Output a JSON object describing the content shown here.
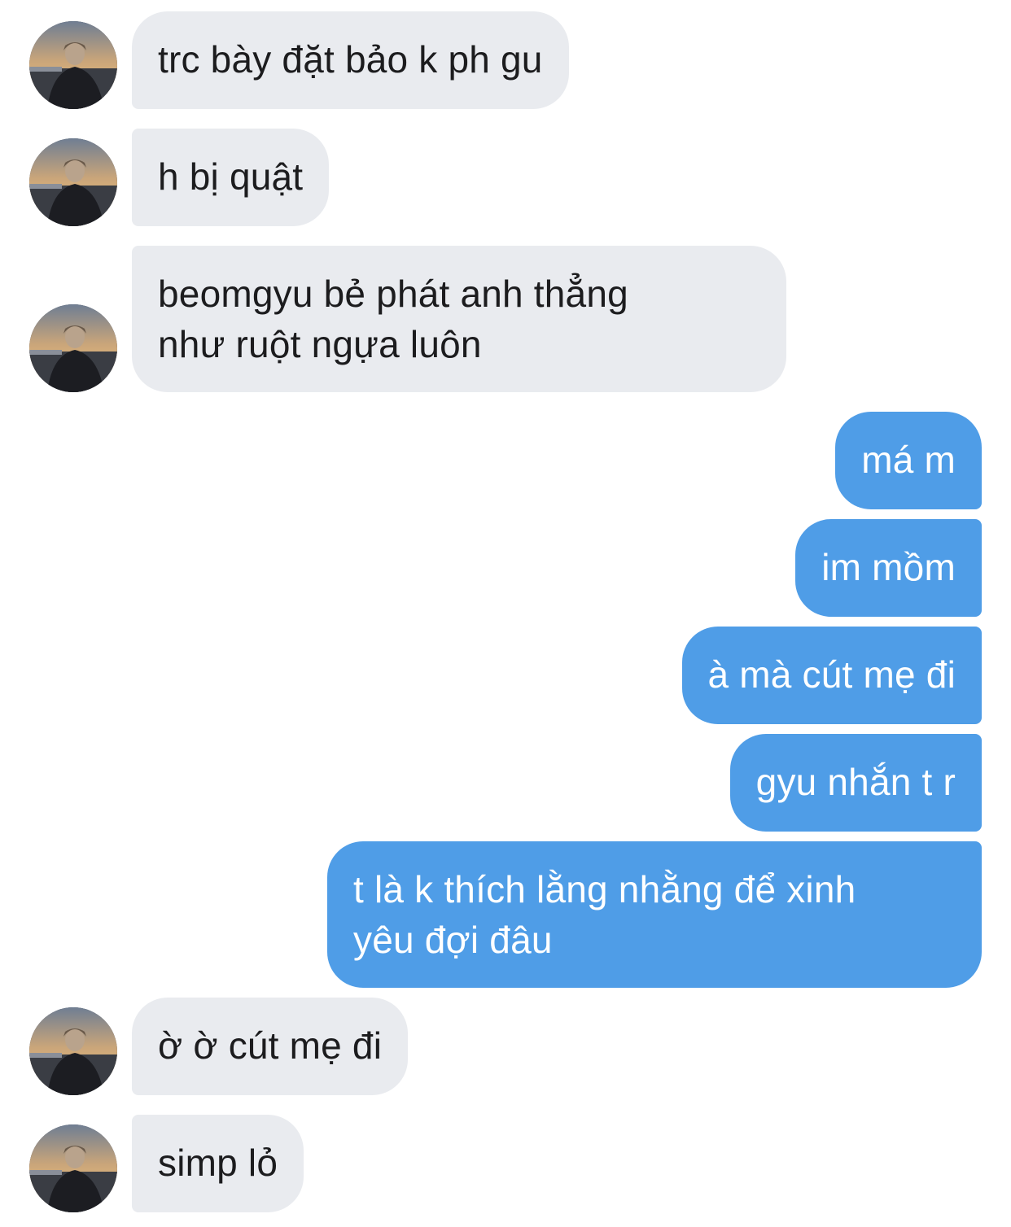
{
  "colors": {
    "incoming_bubble": "#e9ebef",
    "outgoing_bubble": "#4f9de7",
    "incoming_text": "#1c1c1e",
    "outgoing_text": "#ffffff",
    "background": "#ffffff"
  },
  "messages": [
    {
      "sender": "other",
      "text": "trc bày đặt bảo k ph gu"
    },
    {
      "sender": "other",
      "text": "h bị quật"
    },
    {
      "sender": "other",
      "text": "beomgyu bẻ phát anh thẳng\nnhư ruột ngựa luôn"
    },
    {
      "sender": "me",
      "text": "má m"
    },
    {
      "sender": "me",
      "text": "im mồm"
    },
    {
      "sender": "me",
      "text": "à mà cút mẹ đi"
    },
    {
      "sender": "me",
      "text": "gyu nhắn t r"
    },
    {
      "sender": "me",
      "text": "t là k thích lằng nhằng để xinh\nyêu đợi đâu"
    },
    {
      "sender": "other",
      "text": "ờ ờ cút mẹ đi"
    },
    {
      "sender": "other",
      "text": "simp lỏ"
    }
  ],
  "avatar": {
    "icon": "profile-photo-avatar"
  }
}
